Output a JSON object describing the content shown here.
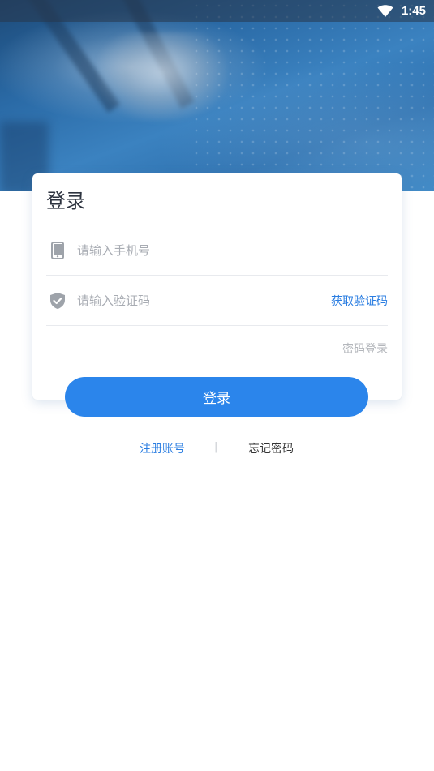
{
  "status_bar": {
    "time": "1:45",
    "icons": [
      "wifi-icon"
    ]
  },
  "login_card": {
    "title": "登录",
    "phone_field": {
      "placeholder": "请输入手机号",
      "value": "",
      "icon": "phone-icon"
    },
    "code_field": {
      "placeholder": "请输入验证码",
      "value": "",
      "icon": "shield-check-icon",
      "get_code_label": "获取验证码"
    },
    "password_login_label": "密码登录"
  },
  "login_button_label": "登录",
  "links": {
    "register_label": "注册账号",
    "divider": "|",
    "forgot_label": "忘记密码"
  },
  "colors": {
    "accent": "#2b85eb",
    "link": "#2a7de1",
    "placeholder": "#a8acb3"
  }
}
